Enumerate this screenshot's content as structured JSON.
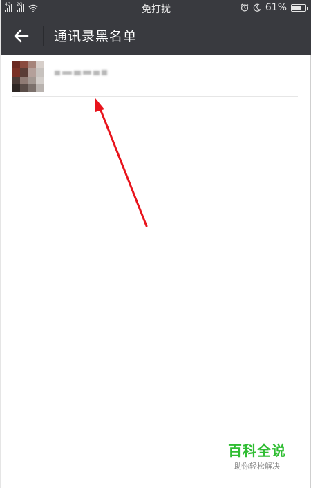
{
  "status_bar": {
    "signal1_label": "4G",
    "signal2_label": "2G",
    "center_text": "免打扰",
    "battery_text": "61%",
    "battery_level": 0.61,
    "icons": [
      "signal-icon",
      "wifi-icon",
      "alarm-icon",
      "moon-icon",
      "battery-icon"
    ]
  },
  "nav": {
    "title": "通讯录黑名单",
    "back_icon": "arrow-left-icon"
  },
  "contacts": [
    {
      "name_redacted": true,
      "avatar_redacted": true
    }
  ],
  "annotation": {
    "arrow_color": "#e8141c"
  },
  "watermark": {
    "title": "百科全说",
    "subtitle": "助你轻松解决",
    "color": "#2fbd32"
  },
  "colors": {
    "bar_bg": "#393a3f",
    "page_bg": "#ffffff"
  }
}
